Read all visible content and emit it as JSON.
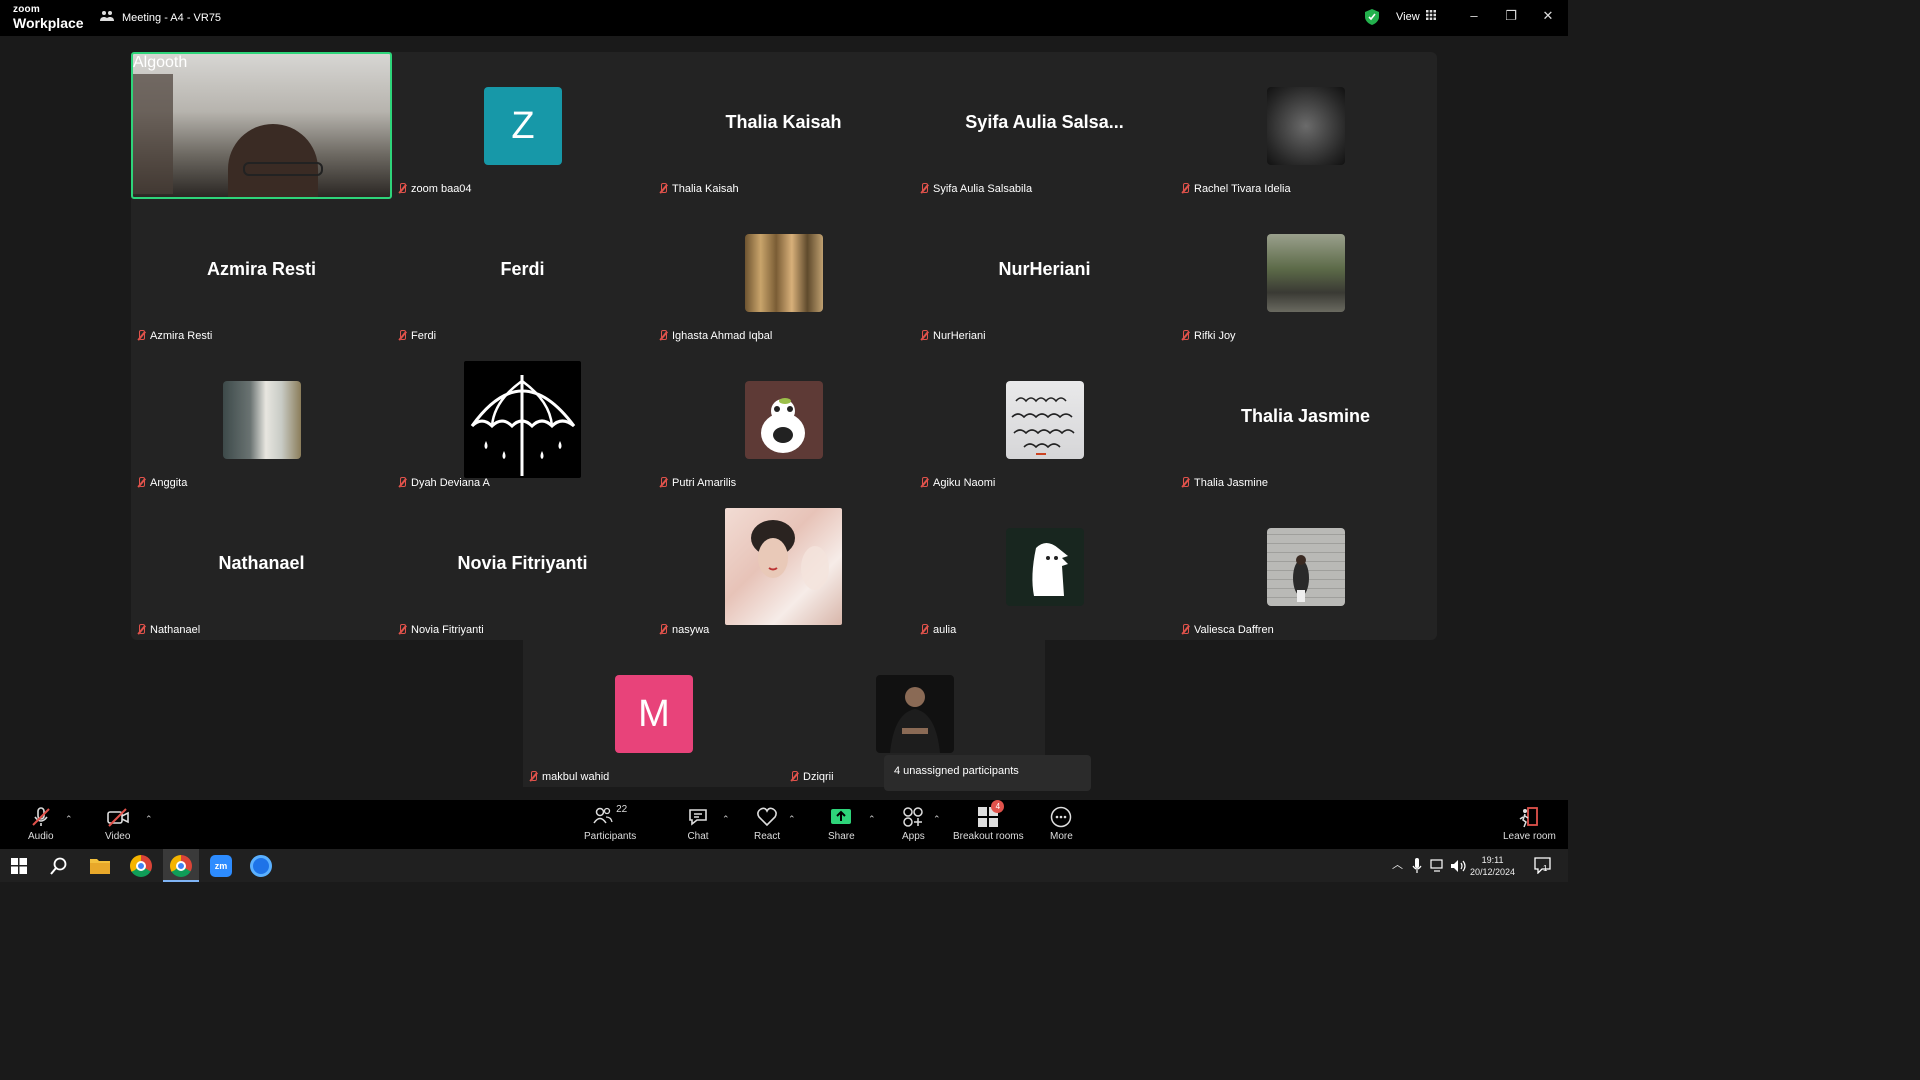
{
  "titlebar": {
    "logo_top": "zoom",
    "logo_bottom": "Workplace",
    "meeting_title": "Meeting - A4 - VR75",
    "view_label": "View"
  },
  "tiles": [
    {
      "label": "Algooth"
    },
    {
      "label": "zoom baa04",
      "avatar_letter": "Z",
      "avatar_color": "#1798a8"
    },
    {
      "label": "Thalia Kaisah",
      "big_name": "Thalia Kaisah"
    },
    {
      "label": "Syifa Aulia Salsabila",
      "big_name": "Syifa Aulia Salsa..."
    },
    {
      "label": "Rachel Tivara Idelia"
    },
    {
      "label": "Azmira Resti",
      "big_name": "Azmira Resti"
    },
    {
      "label": "Ferdi",
      "big_name": "Ferdi"
    },
    {
      "label": "Ighasta Ahmad Iqbal"
    },
    {
      "label": "NurHeriani",
      "big_name": "NurHeriani"
    },
    {
      "label": "Rifki Joy"
    },
    {
      "label": "Anggita"
    },
    {
      "label": "Dyah Deviana A"
    },
    {
      "label": "Putri Amarilis"
    },
    {
      "label": "Agiku Naomi"
    },
    {
      "label": "Thalia Jasmine",
      "big_name": "Thalia Jasmine"
    },
    {
      "label": "Nathanael",
      "big_name": "Nathanael"
    },
    {
      "label": "Novia Fitriyanti",
      "big_name": "Novia Fitriyanti"
    },
    {
      "label": "nasywa"
    },
    {
      "label": "aulia"
    },
    {
      "label": "Valiesca Daffren"
    },
    {
      "label": "makbul wahid",
      "avatar_letter": "M",
      "avatar_color": "#e8437a"
    },
    {
      "label": "Dziqrii"
    }
  ],
  "tooltip": "4 unassigned participants",
  "toolbar": {
    "audio": "Audio",
    "video": "Video",
    "participants": "Participants",
    "participants_count": "22",
    "chat": "Chat",
    "react": "React",
    "share": "Share",
    "apps": "Apps",
    "breakout": "Breakout rooms",
    "breakout_badge": "4",
    "more": "More",
    "leave": "Leave room"
  },
  "taskbar": {
    "time": "19:11",
    "date": "20/12/2024",
    "notif_count": "1"
  },
  "colors": {
    "active_speaker_border": "#2ed47a",
    "share_green": "#2ed47a",
    "muted_red": "#e0524b"
  }
}
